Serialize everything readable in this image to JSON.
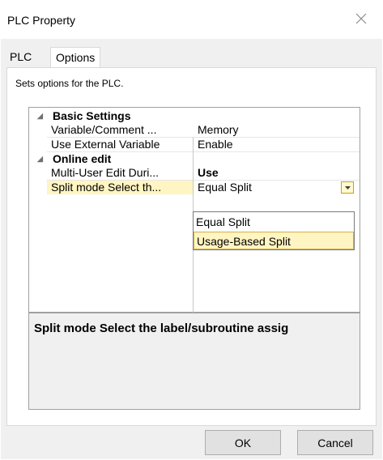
{
  "window": {
    "title": "PLC Property",
    "close_icon": "close-icon"
  },
  "tabs": [
    {
      "label": "PLC"
    },
    {
      "label": "Options"
    }
  ],
  "description": "Sets options for the PLC.",
  "grid": {
    "categories": [
      {
        "label": "Basic Settings",
        "properties": [
          {
            "name": "Variable/Comment ...",
            "value": "Memory"
          },
          {
            "name": "Use External Variable",
            "value": "Enable"
          }
        ]
      },
      {
        "label": "Online edit",
        "properties": [
          {
            "name": "Multi-User Edit Duri...",
            "value": "Use"
          },
          {
            "name": "Split mode Select th...",
            "value": "Equal Split"
          }
        ]
      }
    ]
  },
  "dropdown": {
    "options": [
      "Equal Split",
      "Usage-Based Split"
    ],
    "highlighted": "Usage-Based Split"
  },
  "help_text": "Split mode Select the label/subroutine assig",
  "buttons": {
    "ok": "OK",
    "cancel": "Cancel"
  },
  "colors": {
    "selection": "#fff5c2",
    "dialog_bg": "#f0f0f0"
  }
}
